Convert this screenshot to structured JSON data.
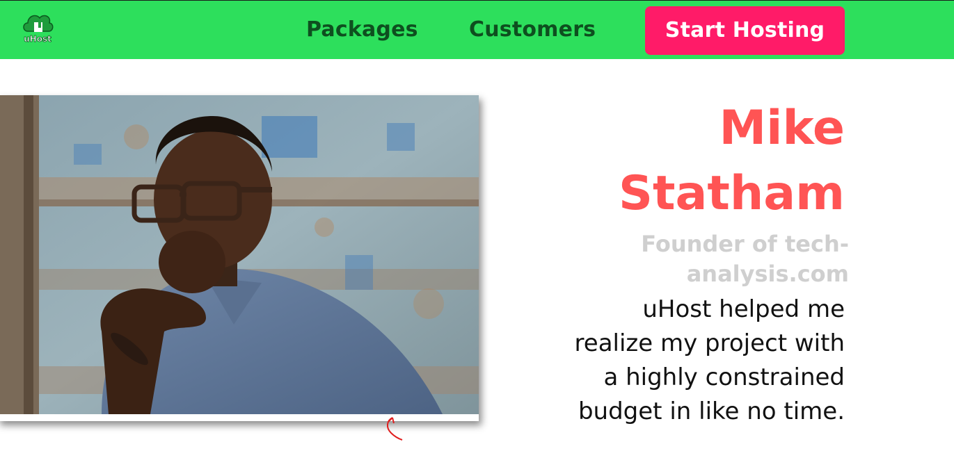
{
  "header": {
    "logo_text": "uHost",
    "nav": {
      "packages_label": "Packages",
      "customers_label": "Customers"
    },
    "cta_label": "Start Hosting",
    "colors": {
      "background": "#2ddf5c",
      "nav_text": "#0e4f1f",
      "cta_background": "#ff1b68"
    }
  },
  "testimonial": {
    "name_line1": "Mike",
    "name_line2": "Statham",
    "role_line1": "Founder of tech-",
    "role_line2": "analysis.com",
    "quote_lines": [
      "uHost helped me",
      "realize my project with",
      "a highly constrained",
      "budget in like no time."
    ],
    "colors": {
      "name": "#ff5454",
      "role": "#cfcfcf"
    }
  }
}
